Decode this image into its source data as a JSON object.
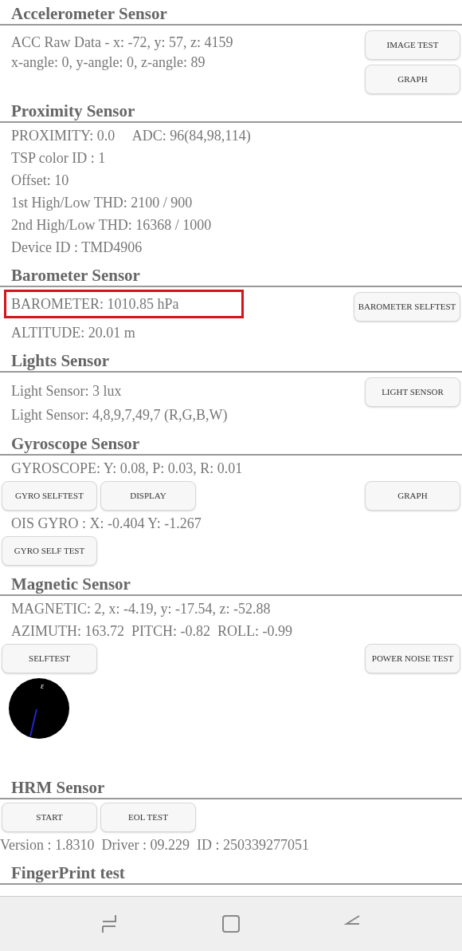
{
  "sections": [
    {
      "title": "Accelerometer Sensor",
      "rows": [
        {
          "kind": "text_buttons",
          "lines": [
            "ACC Raw Data - x: -72, y: 57, z: 4159",
            "x-angle: 0, y-angle: 0, z-angle: 89"
          ],
          "right": [
            "IMAGE TEST",
            "GRAPH"
          ]
        }
      ]
    },
    {
      "title": "Proximity Sensor",
      "rows": [
        {
          "kind": "text",
          "text": "PROXIMITY: 0.0     ADC: 96(84,98,114)",
          "highlighted": false
        },
        {
          "kind": "text",
          "text": "TSP color ID : 1",
          "highlighted": false
        },
        {
          "kind": "text",
          "text": "Offset: 10",
          "highlighted": false
        },
        {
          "kind": "text",
          "text": "1st High/Low THD: 2100 / 900",
          "highlighted": false
        },
        {
          "kind": "text",
          "text": "2nd High/Low THD: 16368 / 1000",
          "highlighted": false
        },
        {
          "kind": "text",
          "text": "Device ID : TMD4906",
          "highlighted": false
        }
      ]
    },
    {
      "title": "Barometer Sensor",
      "rows": [
        {
          "kind": "text_buttons",
          "lines": [
            "BAROMETER: 1010.85 hPa"
          ],
          "highlighted": true,
          "right": [
            "BAROMETER SELFTEST"
          ]
        },
        {
          "kind": "text",
          "text": "ALTITUDE: 20.01 m",
          "highlighted": false
        }
      ]
    },
    {
      "title": "Lights Sensor",
      "rows": [
        {
          "kind": "text_buttons",
          "lines": [
            "Light Sensor: 3 lux",
            "Light Sensor: 4,8,9,7,49,7 (R,G,B,W)"
          ],
          "right": [
            "LIGHT SENSOR"
          ]
        }
      ]
    },
    {
      "title": "Gyroscope Sensor",
      "rows": [
        {
          "kind": "text",
          "text": "GYROSCOPE: Y: 0.08, P: 0.03, R: 0.01",
          "highlighted": false
        },
        {
          "kind": "buttons",
          "left": [
            "GYRO SELFTEST",
            "DISPLAY"
          ],
          "right": [
            "GRAPH"
          ]
        },
        {
          "kind": "text",
          "text": "OIS GYRO : X: -0.404 Y: -1.267",
          "highlighted": false
        },
        {
          "kind": "buttons",
          "left": [
            "GYRO SELF TEST"
          ]
        }
      ]
    },
    {
      "title": "Magnetic Sensor",
      "rows": [
        {
          "kind": "text",
          "text": "MAGNETIC: 2, x: -4.19, y: -17.54, z: -52.88",
          "highlighted": false
        },
        {
          "kind": "text",
          "text": "AZIMUTH: 163.72  PITCH: -0.82  ROLL: -0.99",
          "highlighted": false
        },
        {
          "kind": "buttons",
          "left": [
            "SELFTEST"
          ],
          "right": [
            "POWER NOISE TEST"
          ]
        },
        {
          "kind": "compass",
          "mark": "ε"
        }
      ]
    },
    {
      "title": "HRM Sensor",
      "rows": [
        {
          "kind": "buttons",
          "left": [
            "START",
            "EOL TEST"
          ]
        },
        {
          "kind": "text",
          "text": "Version : 1.8310  Driver : 09.229  ID : 250339277051",
          "highlighted": false,
          "flush": true
        }
      ]
    },
    {
      "title": "FingerPrint test"
    }
  ]
}
